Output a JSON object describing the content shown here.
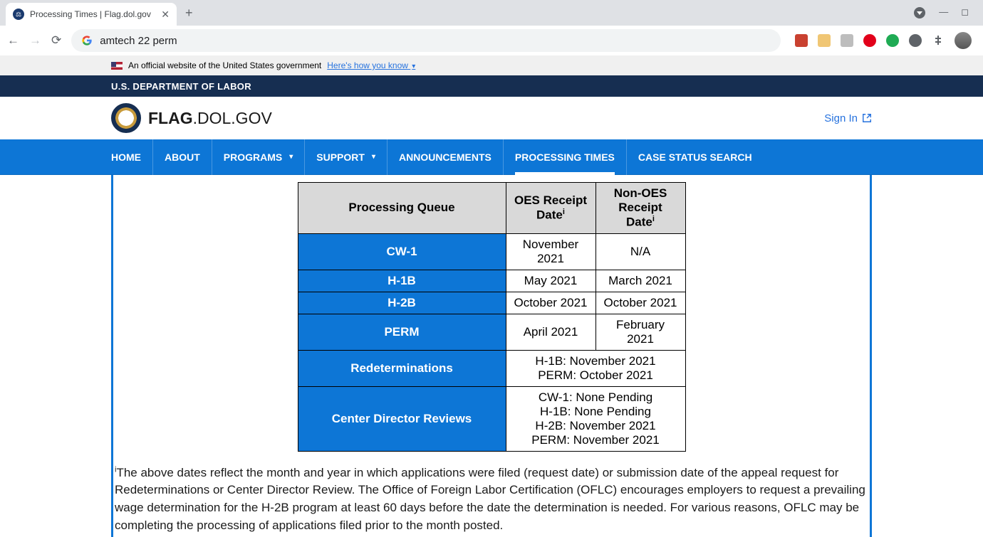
{
  "browser": {
    "tab_title": "Processing Times | Flag.dol.gov",
    "address": "amtech 22 perm"
  },
  "gov_banner": {
    "text": "An official website of the United States government",
    "link": "Here's how you know"
  },
  "dol_bar": "U.S. DEPARTMENT OF LABOR",
  "site_title_bold": "FLAG",
  "site_title_rest": ".DOL.GOV",
  "sign_in": "Sign In",
  "nav": {
    "home": "HOME",
    "about": "ABOUT",
    "programs": "PROGRAMS",
    "support": "SUPPORT",
    "announcements": "ANNOUNCEMENTS",
    "processing": "PROCESSING TIMES",
    "case_status": "CASE STATUS SEARCH"
  },
  "table": {
    "h_queue": "Processing Queue",
    "h_oes": "OES Receipt Date",
    "h_nonoes": "Non-OES Receipt Date",
    "rows": {
      "cw1": {
        "label": "CW-1",
        "oes": "November 2021",
        "nonoes": "N/A"
      },
      "h1b": {
        "label": "H-1B",
        "oes": "May 2021",
        "nonoes": "March 2021"
      },
      "h2b": {
        "label": "H-2B",
        "oes": "October 2021",
        "nonoes": "October 2021"
      },
      "perm": {
        "label": "PERM",
        "oes": "April 2021",
        "nonoes": "February 2021"
      },
      "redet": {
        "label": "Redeterminations",
        "line1": "H-1B: November 2021",
        "line2": "PERM: October 2021"
      },
      "cdr": {
        "label": "Center Director Reviews",
        "line1": "CW-1: None Pending",
        "line2": "H-1B: None Pending",
        "line3": "H-2B: November 2021",
        "line4": "PERM: November 2021"
      }
    }
  },
  "footnote": "The above dates reflect the month and year in which applications were filed (request date) or submission date of the appeal request for Redeterminations or Center Director Review. The Office of Foreign Labor Certification (OFLC) encourages employers to request a prevailing wage determination for the H-2B program at least 60 days before the date the determination is needed. For various reasons, OFLC may be completing the processing of applications filed prior to the month posted."
}
